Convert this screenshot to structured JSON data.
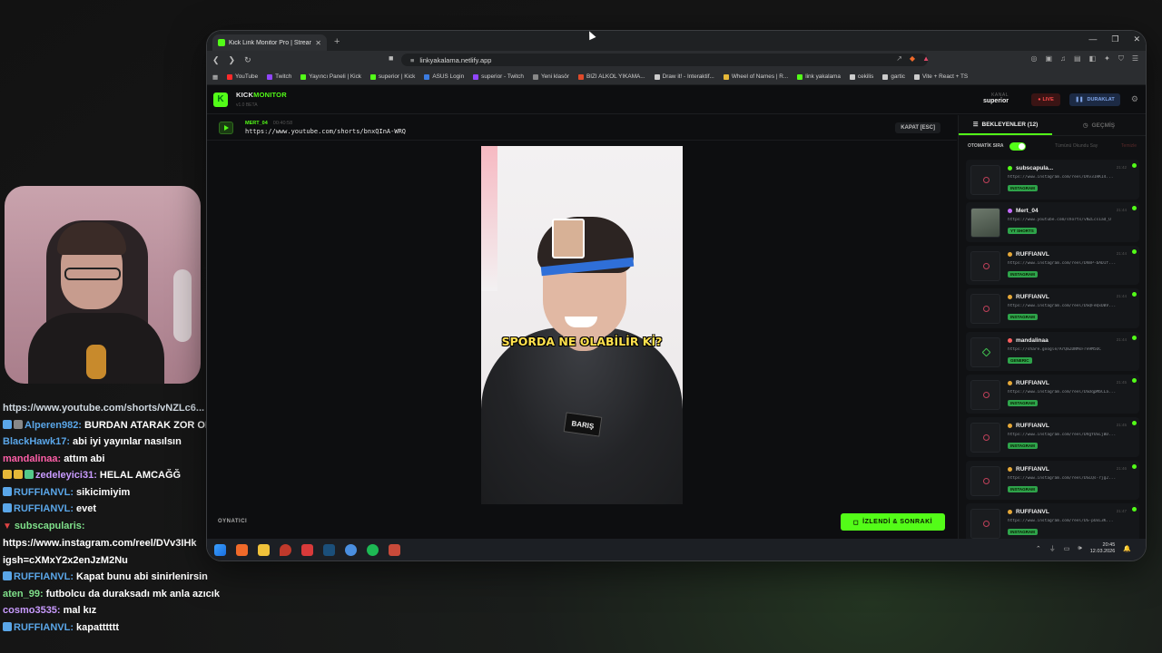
{
  "chat": [
    {
      "user": "",
      "text": "https://www.youtube.com/shorts/vNZLc6...",
      "user_color": "#cfd8e0",
      "badges": [],
      "cut": true
    },
    {
      "user": "Alperen982:",
      "text": "BURDAN ATARAK ZOR OLU",
      "user_color": "#5aa6e8",
      "badges": [
        "blue",
        "shield"
      ]
    },
    {
      "user": "BlackHawk17:",
      "text": "abi iyi yayınlar nasılsın",
      "user_color": "#5aa6e8",
      "badges": []
    },
    {
      "user": "mandalinaa:",
      "text": "attım abi",
      "user_color": "#ff5fa8",
      "badges": []
    },
    {
      "user": "zedeleyici31:",
      "text": "HELAL AMCAĞĞ",
      "user_color": "#c99bff",
      "badges": [
        "yellow",
        "yellow",
        "green"
      ]
    },
    {
      "user": "RUFFIANVL:",
      "text": "sikicimiyim",
      "user_color": "#5aa6e8",
      "badges": [
        "blue"
      ]
    },
    {
      "user": "RUFFIANVL:",
      "text": "evet",
      "user_color": "#5aa6e8",
      "badges": [
        "blue"
      ]
    },
    {
      "user": "subscapularis:",
      "text": "",
      "user_color": "#7fe08a",
      "badges": [
        "red"
      ]
    },
    {
      "user": "",
      "text": "https://www.instagram.com/reel/DVv3IHk",
      "user_color": "#fff",
      "badges": []
    },
    {
      "user": "",
      "text": "igsh=cXMxY2x2enJzM2Nu",
      "user_color": "#fff",
      "badges": []
    },
    {
      "user": "RUFFIANVL:",
      "text": "Kapat bunu abi sinirlenirsin",
      "user_color": "#5aa6e8",
      "badges": [
        "blue"
      ]
    },
    {
      "user": "aten_99:",
      "text": "futbolcu da duraksadı mk anla azıcık",
      "user_color": "#7fe08a",
      "badges": []
    },
    {
      "user": "cosmo3535:",
      "text": "mal kız",
      "user_color": "#c99bff",
      "badges": []
    },
    {
      "user": "RUFFIANVL:",
      "text": "kapatttttt",
      "user_color": "#5aa6e8",
      "badges": [
        "blue"
      ]
    }
  ],
  "browser": {
    "tab_title": "Kick Link Monitor Pro | Stream",
    "url": "linkyakalama.netlify.app",
    "bookmarks": [
      {
        "label": "YouTube",
        "color": "#ff2a2a"
      },
      {
        "label": "Twitch",
        "color": "#9146ff"
      },
      {
        "label": "Yayıncı Paneli | Kick",
        "color": "#53fc18"
      },
      {
        "label": "superior | Kick",
        "color": "#53fc18"
      },
      {
        "label": "ASUS Login",
        "color": "#3b7be0"
      },
      {
        "label": "superior - Twitch",
        "color": "#9146ff"
      },
      {
        "label": "Yeni klasör",
        "color": "#888"
      },
      {
        "label": "BIZI ALKOL YIKAMA...",
        "color": "#e04a2a"
      },
      {
        "label": "Draw it! - Interaktif...",
        "color": "#ccc"
      },
      {
        "label": "Wheel of Names | R...",
        "color": "#e6b838"
      },
      {
        "label": "link yakalama",
        "color": "#53fc18"
      },
      {
        "label": "cekilis",
        "color": "#ccc"
      },
      {
        "label": "gartic",
        "color": "#ccc"
      },
      {
        "label": "Vite + React + TS",
        "color": "#ccc"
      }
    ]
  },
  "app": {
    "brand_kick": "KICK",
    "brand_monitor": "MONITOR",
    "version": "v1.0 BETA",
    "kanal_label": "KANAL",
    "kanal_value": "superior",
    "live_label": "LIVE",
    "pause_label": "DURAKLAT",
    "now_playing": {
      "user": "MERT_04",
      "time": "00:40:58",
      "url": "https://www.youtube.com/shorts/bnxQInA-WRQ",
      "close_label": "KAPAT [ESC]"
    },
    "video_caption": "SPORDA NE OLABİLİR Kİ?",
    "video_badge": "BARIŞ",
    "player_label": "OYNATICI",
    "next_label": "İZLENDİ & SONRAKİ"
  },
  "sidebar": {
    "tab_waiting": "BEKLEYENLER (12)",
    "tab_history": "GEÇMİŞ",
    "auto_label": "OTOMATİK SIRA",
    "mark_all": "Tümünü Okundu Say",
    "delete_label": "Temizle",
    "queue": [
      {
        "user": "subscapula...",
        "time": "21:42",
        "url": "https://www.instagram.com/reel/DVv3IHKI4...",
        "tag": "INSTAGRAM",
        "dot": "#53fc18",
        "thumb": "ig"
      },
      {
        "user": "Mert_04",
        "time": "21:44",
        "url": "https://www.youtube.com/shorts/vNZLcs1ad_U",
        "tag": "YT SHORTS",
        "dot": "#c66bff",
        "thumb": "photo"
      },
      {
        "user": "RUFFIANVL",
        "time": "21:44",
        "url": "https://www.instagram.com/reel/DVmP-bAD1f...",
        "tag": "INSTAGRAM",
        "dot": "#e6a838",
        "thumb": "ig"
      },
      {
        "user": "RUFFIANVL",
        "time": "21:44",
        "url": "https://www.instagram.com/reel/DSQFeQxDBV...",
        "tag": "INSTAGRAM",
        "dot": "#e6a838",
        "thumb": "ig"
      },
      {
        "user": "mandalinaa",
        "time": "21:44",
        "url": "https://share.google/ArQm2DNMsFre9M5OC",
        "tag": "GENERIC",
        "dot": "#ff5f5f",
        "thumb": "link"
      },
      {
        "user": "RUFFIANVL",
        "time": "21:45",
        "url": "https://www.instagram.com/reel/DSDqpMbCLa...",
        "tag": "INSTAGRAM",
        "dot": "#e6a838",
        "thumb": "ig"
      },
      {
        "user": "RUFFIANVL",
        "time": "21:45",
        "url": "https://www.instagram.com/reel/DVgYUSLjBD...",
        "tag": "INSTAGRAM",
        "dot": "#e6a838",
        "thumb": "ig"
      },
      {
        "user": "RUFFIANVL",
        "time": "21:46",
        "url": "https://www.instagram.com/reel/DSLQs-rjg2...",
        "tag": "INSTAGRAM",
        "dot": "#e6a838",
        "thumb": "ig"
      },
      {
        "user": "RUFFIANVL",
        "time": "21:47",
        "url": "https://www.instagram.com/reel/DS-pUxL3K...",
        "tag": "INSTAGRAM",
        "dot": "#e6a838",
        "thumb": "ig"
      }
    ]
  },
  "taskbar": {
    "time": "20:45",
    "date": "12.03.2026"
  },
  "colors": {
    "accent": "#53fc18",
    "live": "#ff4a4a",
    "tag_bg": "#2ea34a"
  }
}
